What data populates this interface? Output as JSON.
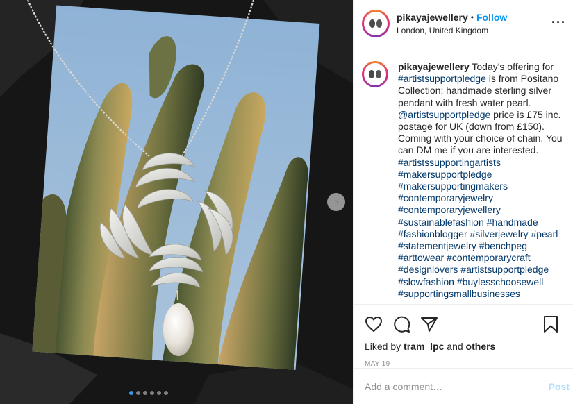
{
  "post": {
    "username": "pikayajewellery",
    "separator": "•",
    "follow_label": "Follow",
    "location": "London, United Kingdom",
    "more_label": "···",
    "carousel": {
      "slide_count": 6,
      "active_index": 0,
      "next_glyph": "›"
    }
  },
  "caption": {
    "username": "pikayajewellery",
    "lines": [
      [
        {
          "t": "text",
          "v": "Today's offering for"
        }
      ],
      [
        {
          "t": "tag",
          "v": "#artistsupportpledge"
        },
        {
          "t": "text",
          "v": " is from Positano"
        }
      ],
      [
        {
          "t": "text",
          "v": "Collection; handmade sterling silver"
        }
      ],
      [
        {
          "t": "text",
          "v": "pendant with fresh water pearl."
        }
      ],
      [
        {
          "t": "mention",
          "v": "@artistsupportpledge"
        },
        {
          "t": "text",
          "v": " price is £75 inc."
        }
      ],
      [
        {
          "t": "text",
          "v": "postage for UK (down from £150)."
        }
      ],
      [
        {
          "t": "text",
          "v": "Coming with your choice of chain. You"
        }
      ],
      [
        {
          "t": "text",
          "v": "can DM me if you are interested."
        }
      ],
      [
        {
          "t": "tag",
          "v": "#artistssupportingartists"
        }
      ],
      [
        {
          "t": "tag",
          "v": "#makersupportpledge"
        }
      ],
      [
        {
          "t": "tag",
          "v": "#makersupportingmakers"
        }
      ],
      [
        {
          "t": "tag",
          "v": "#contemporaryjewelry"
        }
      ],
      [
        {
          "t": "tag",
          "v": "#contemporaryjewellery"
        }
      ],
      [
        {
          "t": "tag",
          "v": "#sustainablefashion"
        },
        {
          "t": "text",
          "v": " "
        },
        {
          "t": "tag",
          "v": "#handmade"
        }
      ],
      [
        {
          "t": "tag",
          "v": "#fashionblogger"
        },
        {
          "t": "text",
          "v": " "
        },
        {
          "t": "tag",
          "v": "#silverjewelry"
        },
        {
          "t": "text",
          "v": " "
        },
        {
          "t": "tag",
          "v": "#pearl"
        }
      ],
      [
        {
          "t": "tag",
          "v": "#statementjewelry"
        },
        {
          "t": "text",
          "v": " "
        },
        {
          "t": "tag",
          "v": "#benchpeg"
        }
      ],
      [
        {
          "t": "tag",
          "v": "#arttowear"
        },
        {
          "t": "text",
          "v": " "
        },
        {
          "t": "tag",
          "v": "#contemporarycraft"
        }
      ],
      [
        {
          "t": "tag",
          "v": "#designlovers"
        },
        {
          "t": "text",
          "v": " "
        },
        {
          "t": "tag",
          "v": "#artistsupportpledge"
        }
      ],
      [
        {
          "t": "tag",
          "v": "#slowfashion"
        },
        {
          "t": "text",
          "v": " "
        },
        {
          "t": "tag",
          "v": "#buylesschoosewell"
        }
      ],
      [
        {
          "t": "tag",
          "v": "#supportingsmallbusinesses"
        }
      ]
    ]
  },
  "actions": {
    "icons": [
      "heart-icon",
      "comment-icon",
      "share-icon",
      "bookmark-icon"
    ],
    "liked_prefix": "Liked by",
    "liked_user": "tram_lpc",
    "liked_and": "and",
    "liked_others": "others",
    "date": "MAY 19"
  },
  "comment": {
    "placeholder": "Add a comment…",
    "post_label": "Post"
  },
  "colors": {
    "link": "#00376b",
    "follow": "#0095f6",
    "post_disabled": "#b2dffc",
    "carousel_active_dot": "#3897f0"
  }
}
